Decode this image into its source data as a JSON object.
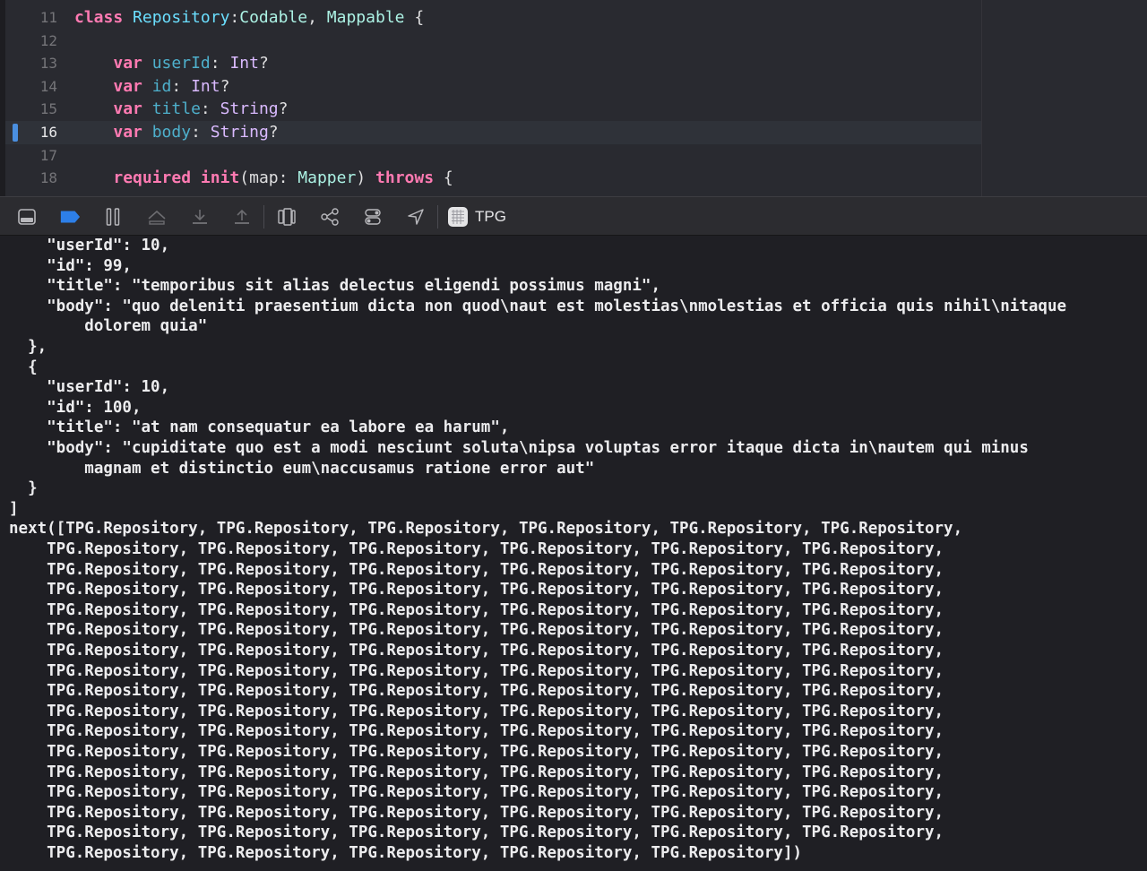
{
  "editor": {
    "lines": [
      {
        "num": "11",
        "parts": [
          [
            "kw",
            "class"
          ],
          [
            "plain",
            " "
          ],
          [
            "tp",
            "Repository"
          ],
          [
            "plain",
            ":"
          ],
          [
            "typ",
            "Codable"
          ],
          [
            "plain",
            ", "
          ],
          [
            "typ",
            "Mappable"
          ],
          [
            "plain",
            " {"
          ]
        ]
      },
      {
        "num": "12",
        "parts": []
      },
      {
        "num": "13",
        "parts": [
          [
            "plain",
            "    "
          ],
          [
            "kw",
            "var"
          ],
          [
            "plain",
            " "
          ],
          [
            "prop",
            "userId"
          ],
          [
            "plain",
            ": "
          ],
          [
            "tp2",
            "Int"
          ],
          [
            "plain",
            "?"
          ]
        ]
      },
      {
        "num": "14",
        "parts": [
          [
            "plain",
            "    "
          ],
          [
            "kw",
            "var"
          ],
          [
            "plain",
            " "
          ],
          [
            "prop",
            "id"
          ],
          [
            "plain",
            ": "
          ],
          [
            "tp2",
            "Int"
          ],
          [
            "plain",
            "?"
          ]
        ]
      },
      {
        "num": "15",
        "parts": [
          [
            "plain",
            "    "
          ],
          [
            "kw",
            "var"
          ],
          [
            "plain",
            " "
          ],
          [
            "prop",
            "title"
          ],
          [
            "plain",
            ": "
          ],
          [
            "tp2",
            "String"
          ],
          [
            "plain",
            "?"
          ]
        ]
      },
      {
        "num": "16",
        "parts": [
          [
            "plain",
            "    "
          ],
          [
            "kw",
            "var"
          ],
          [
            "plain",
            " "
          ],
          [
            "prop",
            "body"
          ],
          [
            "plain",
            ": "
          ],
          [
            "tp2",
            "String"
          ],
          [
            "plain",
            "?"
          ]
        ],
        "current": true
      },
      {
        "num": "17",
        "parts": []
      },
      {
        "num": "18",
        "parts": [
          [
            "plain",
            "    "
          ],
          [
            "kw",
            "required"
          ],
          [
            "plain",
            " "
          ],
          [
            "kw",
            "init"
          ],
          [
            "plain",
            "(map: "
          ],
          [
            "typ",
            "Mapper"
          ],
          [
            "plain",
            ") "
          ],
          [
            "kw",
            "throws"
          ],
          [
            "plain",
            " {"
          ]
        ]
      }
    ]
  },
  "toolbar": {
    "icons": [
      "hide-debug-area-icon",
      "breakpoints-toggle-icon",
      "pause-icon",
      "step-over-icon",
      "step-into-icon",
      "step-out-icon",
      "view-hierarchy-icon",
      "memory-graph-icon",
      "environment-overrides-icon",
      "simulate-location-icon",
      "app-icon"
    ],
    "target_label": "TPG"
  },
  "console": {
    "lines": [
      "    \"userId\": 10,",
      "    \"id\": 99,",
      "    \"title\": \"temporibus sit alias delectus eligendi possimus magni\",",
      "    \"body\": \"quo deleniti praesentium dicta non quod\\naut est molestias\\nmolestias et officia quis nihil\\nitaque",
      "        dolorem quia\"",
      "  },",
      "  {",
      "    \"userId\": 10,",
      "    \"id\": 100,",
      "    \"title\": \"at nam consequatur ea labore ea harum\",",
      "    \"body\": \"cupiditate quo est a modi nesciunt soluta\\nipsa voluptas error itaque dicta in\\nautem qui minus",
      "        magnam et distinctio eum\\naccusamus ratione error aut\"",
      "  }",
      "]",
      "next([TPG.Repository, TPG.Repository, TPG.Repository, TPG.Repository, TPG.Repository, TPG.Repository,",
      "    TPG.Repository, TPG.Repository, TPG.Repository, TPG.Repository, TPG.Repository, TPG.Repository,",
      "    TPG.Repository, TPG.Repository, TPG.Repository, TPG.Repository, TPG.Repository, TPG.Repository,",
      "    TPG.Repository, TPG.Repository, TPG.Repository, TPG.Repository, TPG.Repository, TPG.Repository,",
      "    TPG.Repository, TPG.Repository, TPG.Repository, TPG.Repository, TPG.Repository, TPG.Repository,",
      "    TPG.Repository, TPG.Repository, TPG.Repository, TPG.Repository, TPG.Repository, TPG.Repository,",
      "    TPG.Repository, TPG.Repository, TPG.Repository, TPG.Repository, TPG.Repository, TPG.Repository,",
      "    TPG.Repository, TPG.Repository, TPG.Repository, TPG.Repository, TPG.Repository, TPG.Repository,",
      "    TPG.Repository, TPG.Repository, TPG.Repository, TPG.Repository, TPG.Repository, TPG.Repository,",
      "    TPG.Repository, TPG.Repository, TPG.Repository, TPG.Repository, TPG.Repository, TPG.Repository,",
      "    TPG.Repository, TPG.Repository, TPG.Repository, TPG.Repository, TPG.Repository, TPG.Repository,",
      "    TPG.Repository, TPG.Repository, TPG.Repository, TPG.Repository, TPG.Repository, TPG.Repository,",
      "    TPG.Repository, TPG.Repository, TPG.Repository, TPG.Repository, TPG.Repository, TPG.Repository,",
      "    TPG.Repository, TPG.Repository, TPG.Repository, TPG.Repository, TPG.Repository, TPG.Repository,",
      "    TPG.Repository, TPG.Repository, TPG.Repository, TPG.Repository, TPG.Repository, TPG.Repository,",
      "    TPG.Repository, TPG.Repository, TPG.Repository, TPG.Repository, TPG.Repository, TPG.Repository,",
      "    TPG.Repository, TPG.Repository, TPG.Repository, TPG.Repository, TPG.Repository])"
    ]
  }
}
